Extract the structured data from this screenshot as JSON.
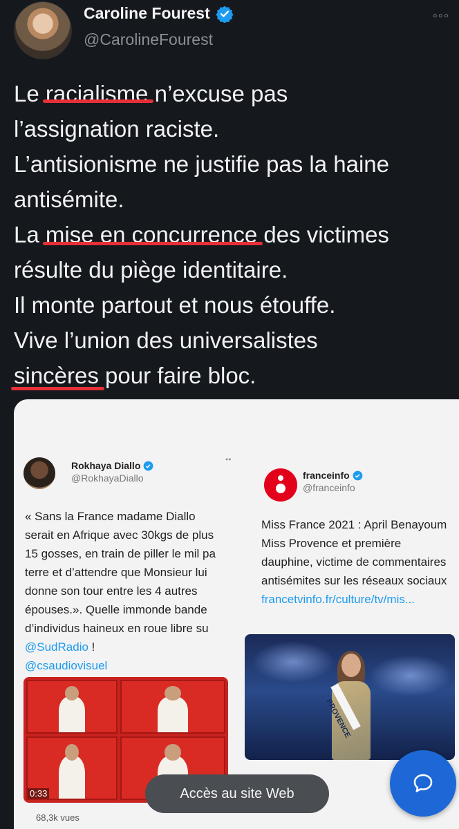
{
  "header": {
    "author_name": "Caroline Fourest",
    "handle": "@CarolineFourest",
    "more_glyph": "◦◦◦"
  },
  "tweet": {
    "lines": [
      {
        "pre": "Le ",
        "underlined": "racialisme",
        "post": " n’excuse pas"
      },
      {
        "text": "l’assignation raciste."
      },
      {
        "text": "L’antisionisme ne justifie pas la haine"
      },
      {
        "text": "antisémite."
      },
      {
        "pre": "La ",
        "underlined": "mise en concurrence",
        "post": " des victimes"
      },
      {
        "text": "résulte du piège identitaire."
      },
      {
        "text": "Il monte partout et nous étouffe."
      },
      {
        "text": "Vive l’union des universalistes"
      },
      {
        "pre": "",
        "underlined": "sincères",
        "post": " pour faire bloc."
      }
    ]
  },
  "quoted_left": {
    "name": "Rokhaya Diallo",
    "handle": "@RokhayaDiallo",
    "more": "••",
    "body_lines": [
      "« Sans la France madame Diallo",
      "serait en Afrique avec 30kgs de plus",
      "15 gosses, en train de piller le mil pa",
      "terre et d’attendre que Monsieur lui",
      "donne son tour entre les 4 autres",
      "épouses.». Quelle immonde bande",
      "d’individus haineux en roue libre su"
    ],
    "link1": "@SudRadio",
    "link1_suffix": " !",
    "link2": "@csaudiovisuel",
    "video_duration": "0:33",
    "views": "68,3k vues"
  },
  "quoted_right": {
    "name": "franceinfo",
    "handle": "@franceinfo",
    "body_lines": [
      "Miss France 2021 : April Benayoum",
      "Miss Provence et première",
      "dauphine, victime de commentaires",
      "antisémites sur les réseaux sociaux"
    ],
    "link": "francetvinfo.fr/culture/tv/mis...",
    "sash_text": "PROVENCE"
  },
  "pill": {
    "label": "Accès au site Web"
  },
  "colors": {
    "background": "#15181c",
    "verified": "#1d9bf0",
    "underline": "#e5303a",
    "fab": "#1d68d6",
    "franceinfo_red": "#e3001b"
  },
  "icons": {
    "verified": "verified-badge-icon",
    "fab": "reply-bubble-icon"
  }
}
